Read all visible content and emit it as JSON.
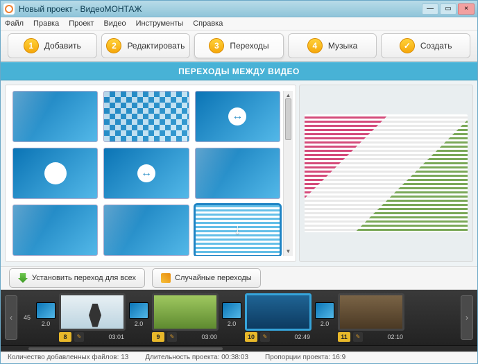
{
  "window": {
    "title": "Новый проект - ВидеоМОНТАЖ"
  },
  "menu": {
    "file": "Файл",
    "edit": "Правка",
    "project": "Проект",
    "video": "Видео",
    "tools": "Инструменты",
    "help": "Справка"
  },
  "tabs": {
    "add": {
      "num": "1",
      "label": "Добавить"
    },
    "edit": {
      "num": "2",
      "label": "Редактировать"
    },
    "trans": {
      "num": "3",
      "label": "Переходы"
    },
    "music": {
      "num": "4",
      "label": "Музыка"
    },
    "make": {
      "num": "✓",
      "label": "Создать"
    }
  },
  "banner": {
    "title": "ПЕРЕХОДЫ МЕЖДУ ВИДЕО"
  },
  "actions": {
    "apply_all": "Установить переход для всех",
    "random": "Случайные переходы"
  },
  "timeline": {
    "start_num": "45",
    "items": [
      {
        "trans": "2.0",
        "num": "8",
        "time": "03:01"
      },
      {
        "trans": "2.0",
        "num": "9",
        "time": "03:00"
      },
      {
        "trans": "2.0",
        "num": "10",
        "time": "02:49"
      },
      {
        "trans": "2.0",
        "num": "11",
        "time": "02:10"
      }
    ]
  },
  "status": {
    "files_label": "Количество добавленных файлов:",
    "files_value": "13",
    "duration_label": "Длительность проекта:",
    "duration_value": "00:38:03",
    "aspect_label": "Пропорции проекта:",
    "aspect_value": "16:9"
  }
}
